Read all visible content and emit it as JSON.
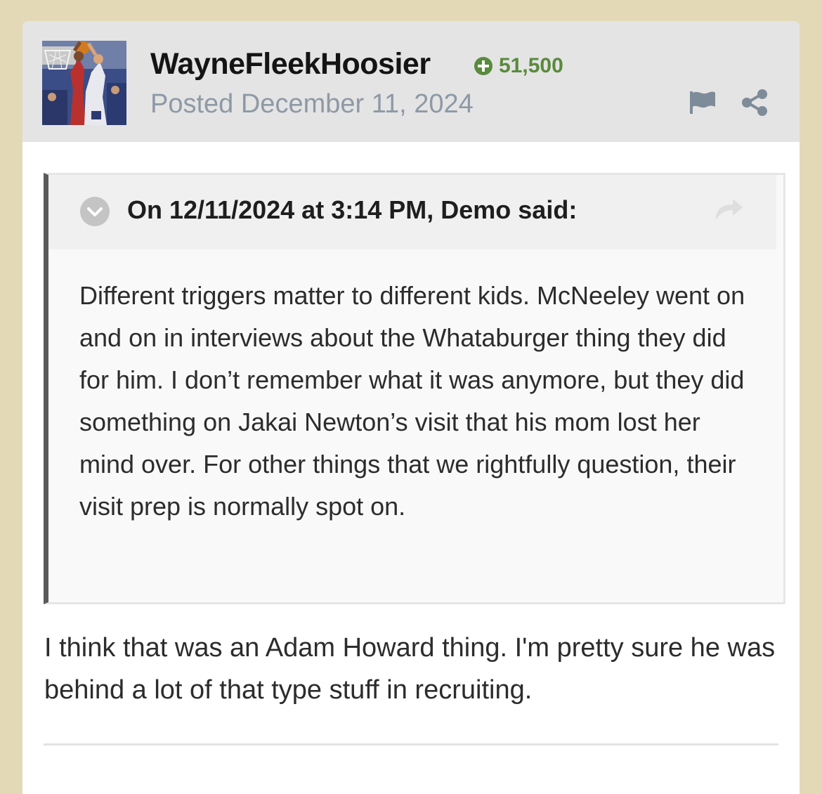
{
  "post": {
    "author": {
      "name": "WayneFleekHoosier",
      "avatar_icon": "avatar-image",
      "reputation": "51,500",
      "reputation_color": "#5a8a3c"
    },
    "posted": "Posted December 11, 2024",
    "actions": {
      "report_icon": "flag-icon",
      "share_icon": "share-icon"
    },
    "quote": {
      "citation": "On 12/11/2024 at 3:14 PM, Demo said:",
      "toggle_icon": "chevron-down-icon",
      "jump_icon": "arrow-forward-icon",
      "text": "Different triggers matter to different kids. McNeeley went on and on in interviews about the Whataburger thing they did for him. I don’t remember what it was anymore, but they did something on Jakai Newton’s visit that his mom lost her mind over. For other things that we rightfully question, their visit prep is normally spot on."
    },
    "reply": {
      "text": "I think that was an Adam Howard thing.  I'm pretty sure he was behind a lot of that type stuff in recruiting."
    }
  },
  "colors": {
    "page_background": "#e3d9b7",
    "header_background": "#e4e4e4",
    "quote_border": "#5a5a5a",
    "meta_text": "#8e99a6"
  }
}
